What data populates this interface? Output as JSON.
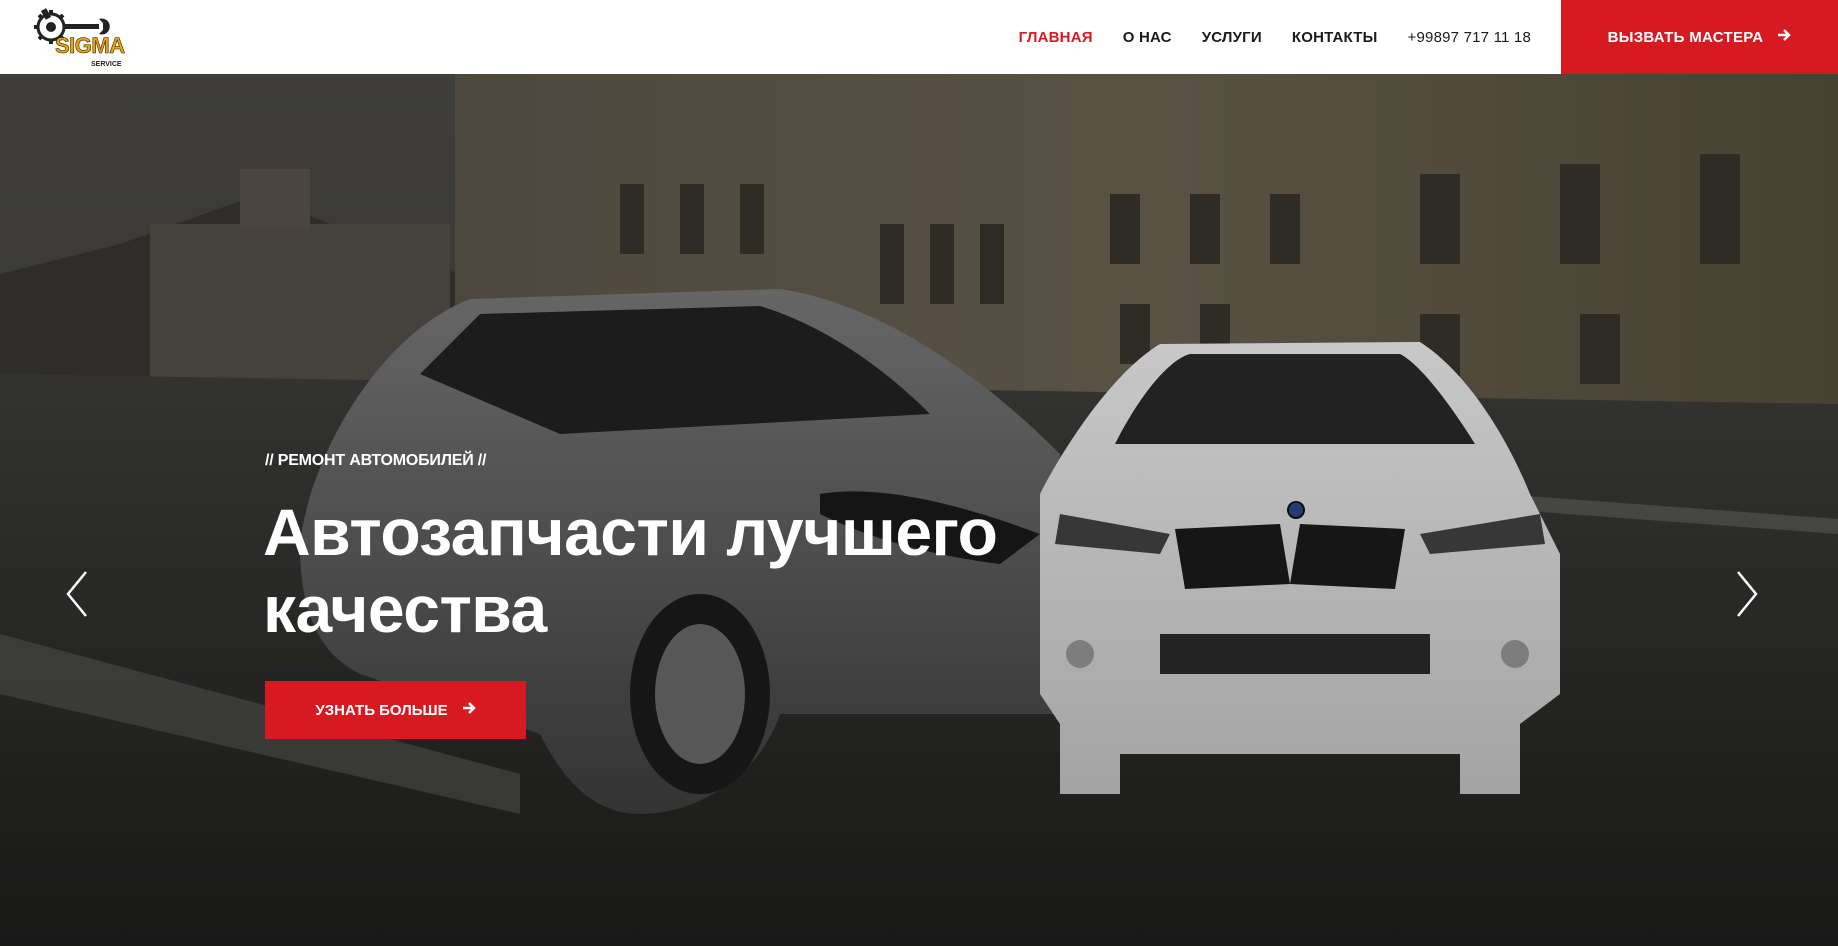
{
  "header": {
    "logo_text": "SIGMA",
    "logo_subtext": "SERVICE",
    "nav": [
      {
        "label": "ГЛАВНАЯ",
        "active": true
      },
      {
        "label": "О НАС",
        "active": false
      },
      {
        "label": "УСЛУГИ",
        "active": false
      },
      {
        "label": "КОНТАКТЫ",
        "active": false
      }
    ],
    "phone": "+99897 717 11 18",
    "cta_label": "ВЫЗВАТЬ МАСТЕРА"
  },
  "hero": {
    "subtitle": "// РЕМОНТ АВТОМОБИЛЕЙ //",
    "title_line1": "Автозапчасти лучшего",
    "title_line2": "качества",
    "button_label": "УЗНАТЬ БОЛЬШЕ"
  },
  "colors": {
    "accent": "#d71a21",
    "logo": "#f0a400",
    "text_dark": "#1a1a1a"
  },
  "icons": {
    "cta_arrow": "arrow-right-icon",
    "button_arrow": "arrow-right-icon",
    "prev": "chevron-left-icon",
    "next": "chevron-right-icon"
  }
}
